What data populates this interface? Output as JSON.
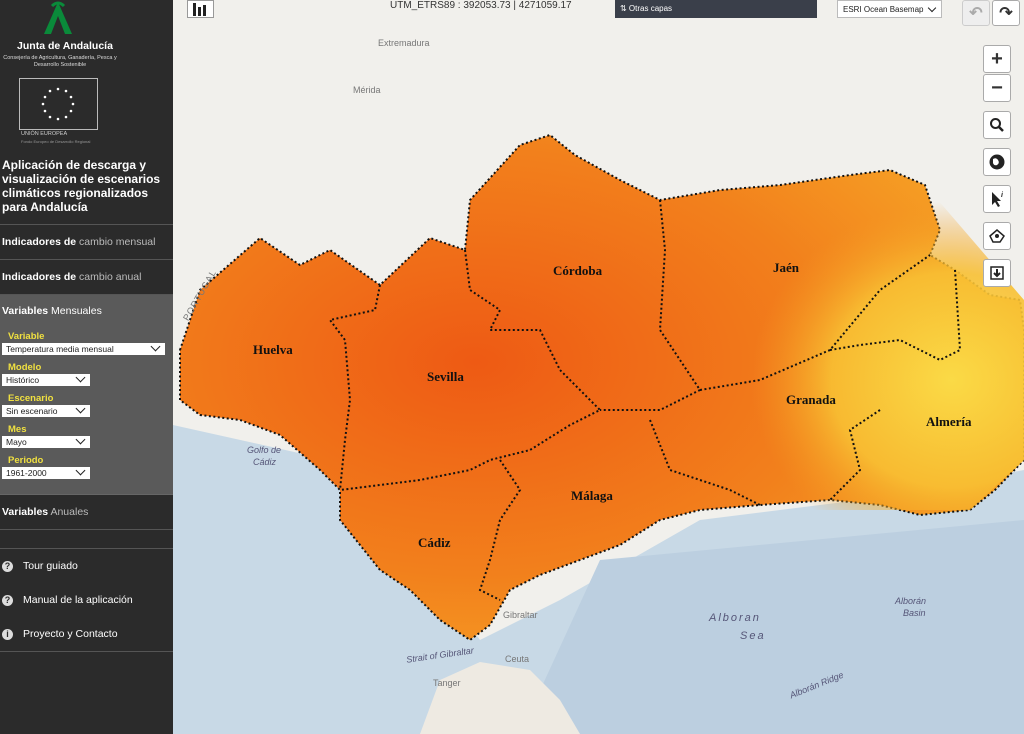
{
  "sidebar": {
    "org_name": "Junta de Andalucía",
    "org_sub": "Consejería de Agricultura, Ganadería, Pesca y Desarrollo Sostenible",
    "eu_caption": "UNIÓN EUROPEA",
    "eu_fund": "Fondo Europeo de Desarrollo Regional",
    "app_title": "Aplicación de descarga y visualización de escenarios climáticos regionalizados para Andalucía",
    "sections": {
      "mensual_a": "Indicadores de",
      "mensual_b": " cambio mensual",
      "anual_a": "Indicadores de",
      "anual_b": " cambio anual",
      "varmens_a": "Variables",
      "varmens_b": " Mensuales",
      "varanu_a": "Variables",
      "varanu_b": " Anuales"
    },
    "fields": {
      "variable_label": "Variable",
      "variable_value": "Temperatura media mensual",
      "modelo_label": "Modelo",
      "modelo_value": "Histórico",
      "escenario_label": "Escenario",
      "escenario_value": "Sin escenario",
      "mes_label": "Mes",
      "mes_value": "Mayo",
      "periodo_label": "Periodo",
      "periodo_value": "1961-2000"
    },
    "links": {
      "tour": "Tour guiado",
      "manual": "Manual de la aplicación",
      "contact": "Proyecto y Contacto"
    }
  },
  "map": {
    "coords": "UTM_ETRS89 : 392053.73 | 4271059.17",
    "layers_label": "⇅ Otras capas",
    "basemap_value": "ESRI Ocean Basemap",
    "provinces": {
      "huelva": "Huelva",
      "sevilla": "Sevilla",
      "cordoba": "Córdoba",
      "jaen": "Jaén",
      "granada": "Granada",
      "almeria": "Almería",
      "malaga": "Málaga",
      "cadiz": "Cádiz"
    },
    "places": {
      "extremadura": "Extremadura",
      "merida": "Mérida",
      "portugal": "PORTUGAL",
      "golfo": "Golfo de",
      "golfo2": "Cádiz",
      "alboran": "Alboran",
      "sea": "Sea",
      "alboran_basin": "Alborán",
      "basin": "Basin",
      "ridge": "Alborán Ridge",
      "strait": "Strait of Gibraltar",
      "ceuta": "Ceuta",
      "tanger": "Tanger",
      "gibraltar": "Gibraltar"
    },
    "colors": {
      "hot": "#f06a18",
      "mid": "#f5a020",
      "cool": "#f9d640",
      "sea": "#c8d9e6",
      "land": "#f1f0ec"
    }
  }
}
